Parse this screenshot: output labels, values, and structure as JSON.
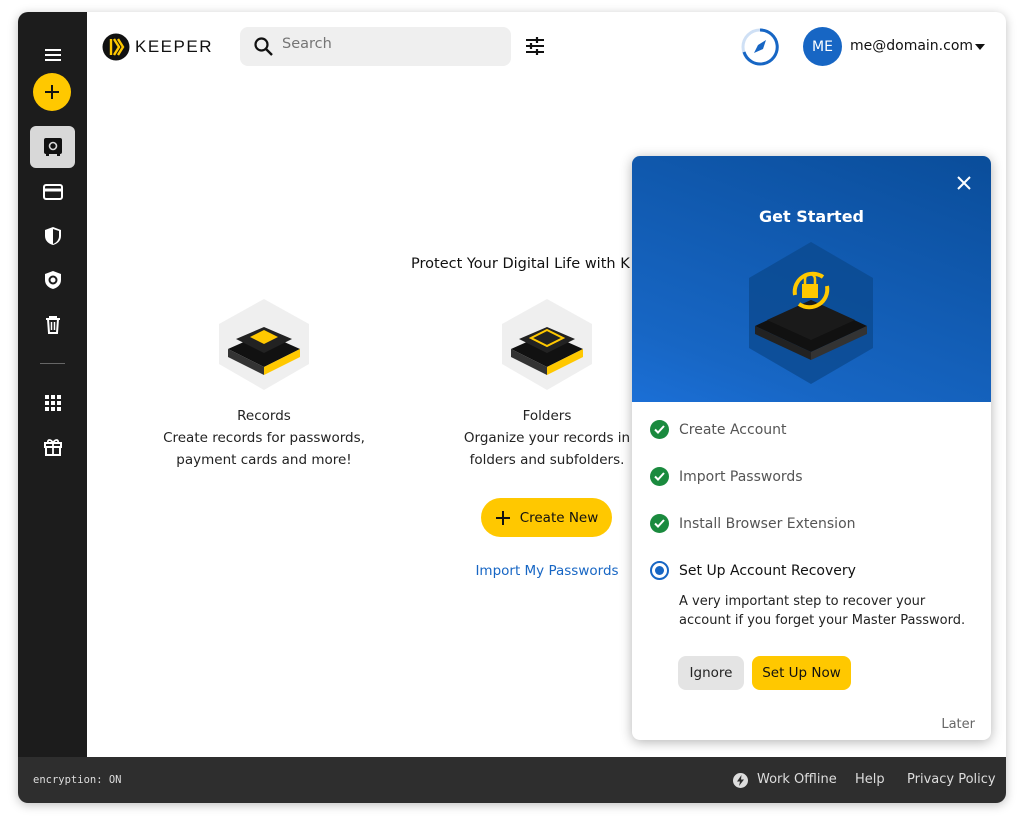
{
  "brand": "KEEPER",
  "search": {
    "placeholder": "Search"
  },
  "user": {
    "initials": "ME",
    "email": "me@domain.com"
  },
  "main": {
    "title": "Protect Your Digital Life with K",
    "features": [
      {
        "title": "Records",
        "line1": "Create records for passwords,",
        "line2": "payment cards and more!"
      },
      {
        "title": "Folders",
        "line1": "Organize your records in",
        "line2": "folders and subfolders."
      }
    ],
    "create_new": "Create New",
    "import": "Import My Passwords"
  },
  "popup": {
    "title": "Get Started",
    "steps": [
      {
        "label": "Create Account",
        "done": true
      },
      {
        "label": "Import Passwords",
        "done": true
      },
      {
        "label": "Install Browser Extension",
        "done": true
      },
      {
        "label": "Set Up Account Recovery",
        "done": false
      }
    ],
    "description_line1": "A very important step to recover your",
    "description_line2": "account if you forget your Master Password.",
    "ignore": "Ignore",
    "setup": "Set Up Now",
    "later": "Later"
  },
  "footer": {
    "encryption": "encryption: ON",
    "offline": "Work Offline",
    "help": "Help",
    "privacy": "Privacy Policy"
  },
  "colors": {
    "accent": "#ffc800",
    "blue": "#1766c4",
    "sidebar": "#1c1c1c",
    "check": "#1a8a3e"
  }
}
